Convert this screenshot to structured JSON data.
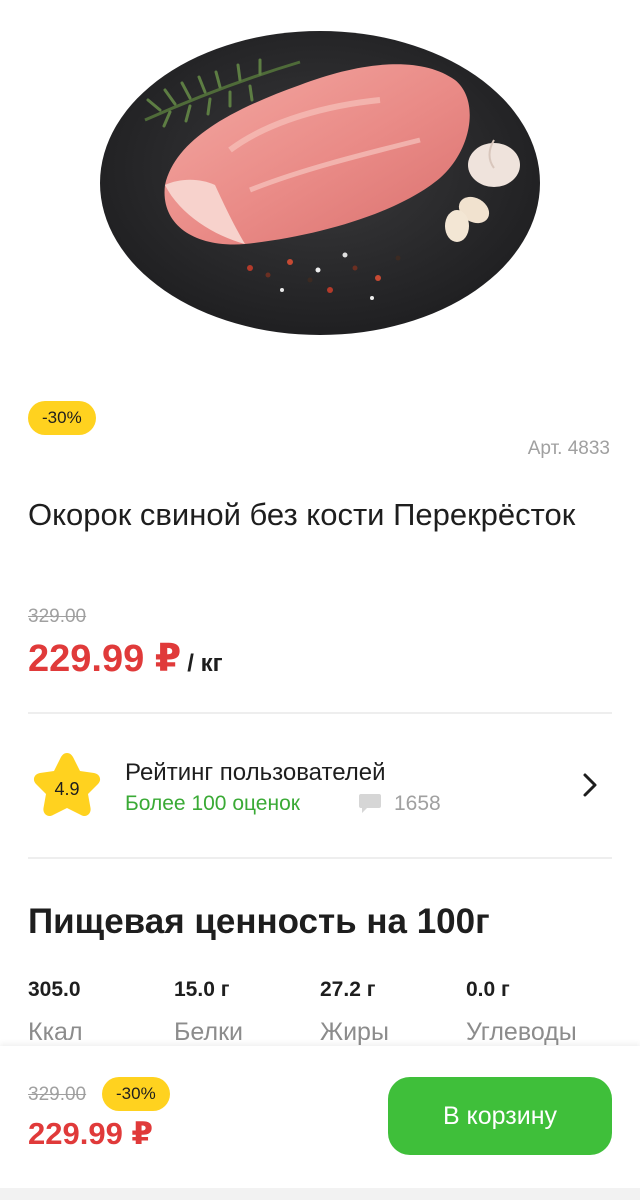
{
  "product": {
    "discount_badge": "-30%",
    "article": "Арт. 4833",
    "title": "Окорок свиной без кости Перекрёсток",
    "old_price": "329.00",
    "price": "229.99 ₽",
    "unit": "/ кг"
  },
  "rating": {
    "value": "4.9",
    "title": "Рейтинг пользователей",
    "subtitle": "Более 100 оценок",
    "comments_count": "1658",
    "star_color": "#ffd21f"
  },
  "nutrition": {
    "title": "Пищевая ценность на 100г",
    "items": [
      {
        "value": "305.0",
        "label": "Ккал"
      },
      {
        "value": "15.0 г",
        "label": "Белки"
      },
      {
        "value": "27.2 г",
        "label": "Жиры"
      },
      {
        "value": "0.0 г",
        "label": "Углеводы"
      }
    ]
  },
  "bottom_bar": {
    "old_price": "329.00",
    "discount_badge": "-30%",
    "price": "229.99 ₽",
    "cart_button": "В корзину"
  },
  "colors": {
    "accent_green": "#3fbf3a",
    "price_red": "#e03a3a",
    "badge_yellow": "#ffd21f"
  },
  "icons": {
    "comment": "comment-icon",
    "chevron": "chevron-right-icon",
    "star": "star-icon"
  }
}
